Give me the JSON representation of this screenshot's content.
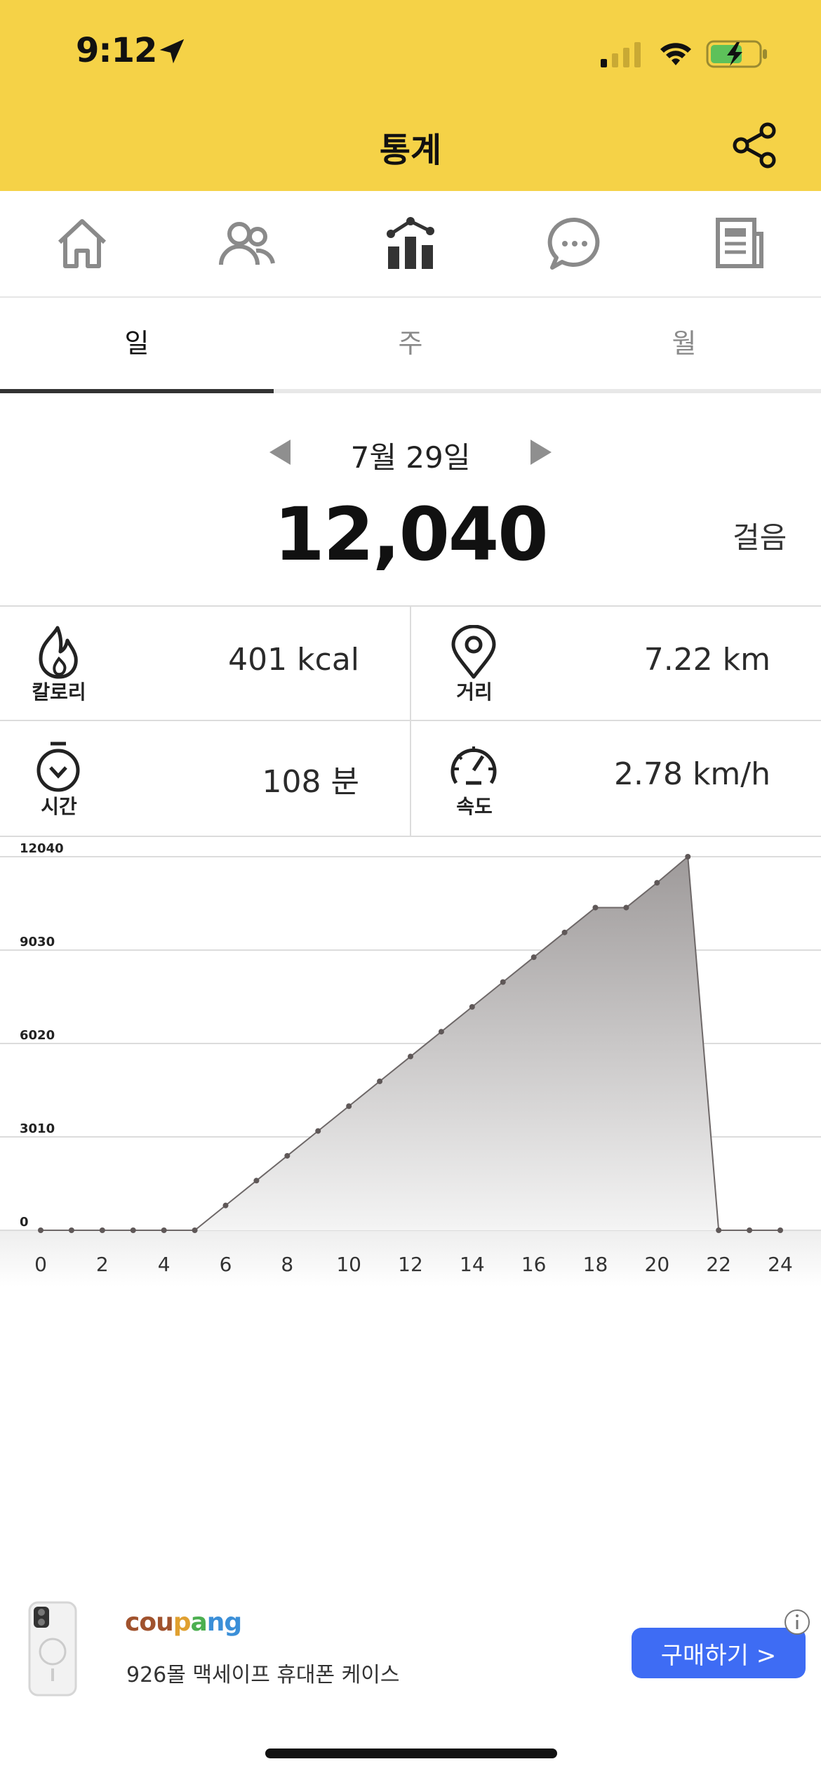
{
  "status_bar": {
    "time": "9:12"
  },
  "header": {
    "title": "통계",
    "share_icon": "share-icon"
  },
  "nav": {
    "items": [
      {
        "name": "home",
        "icon": "home-icon"
      },
      {
        "name": "friends",
        "icon": "people-icon"
      },
      {
        "name": "stats",
        "icon": "chart-icon",
        "active": true
      },
      {
        "name": "chat",
        "icon": "chat-icon"
      },
      {
        "name": "news",
        "icon": "news-icon"
      }
    ]
  },
  "tabs": [
    {
      "label": "일",
      "active": true
    },
    {
      "label": "주",
      "active": false
    },
    {
      "label": "월",
      "active": false
    }
  ],
  "summary": {
    "date": "7월 29일",
    "steps": "12,040",
    "steps_unit": "걸음"
  },
  "stats": {
    "calories": {
      "label": "칼로리",
      "value": "401 kcal"
    },
    "distance": {
      "label": "거리",
      "value": "7.22 km"
    },
    "time": {
      "label": "시간",
      "value": "108 분"
    },
    "speed": {
      "label": "속도",
      "value": "2.78 km/h"
    }
  },
  "chart_data": {
    "type": "area",
    "x": [
      0,
      1,
      2,
      3,
      4,
      5,
      6,
      7,
      8,
      9,
      10,
      11,
      12,
      13,
      14,
      15,
      16,
      17,
      18,
      19,
      20,
      21,
      22,
      23,
      24
    ],
    "values": [
      0,
      0,
      0,
      0,
      0,
      0,
      800,
      1600,
      2400,
      3200,
      4000,
      4800,
      5600,
      6400,
      7200,
      8000,
      8800,
      9600,
      10400,
      10400,
      11200,
      12040,
      0,
      0,
      0
    ],
    "xticks": [
      "0",
      "2",
      "4",
      "6",
      "8",
      "10",
      "12",
      "14",
      "16",
      "18",
      "20",
      "22",
      "24"
    ],
    "yticks": [
      "0",
      "3010",
      "6020",
      "9030",
      "12040"
    ],
    "ylim": [
      0,
      12040
    ],
    "xlim": [
      0,
      24
    ],
    "grid": true
  },
  "ad": {
    "brand": "coupang",
    "text": "926몰 맥세이프 휴대폰 케이스",
    "button": "구매하기 >"
  },
  "colors": {
    "header": "#f5d247",
    "ad_button": "#3e6cf4"
  }
}
